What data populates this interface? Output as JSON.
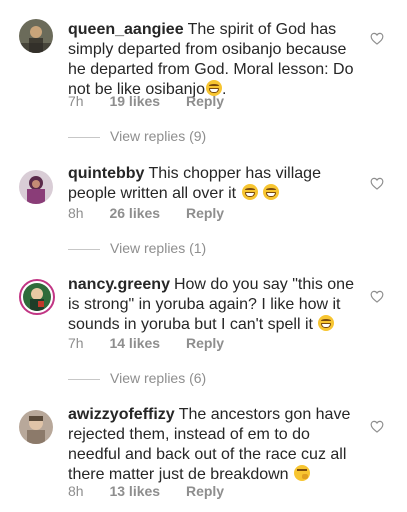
{
  "comments": [
    {
      "username": "queen_aangiee",
      "text": "The spirit of God has simply departed from osibanjo because he departed from God. Moral lesson: Do not be like osibanjo",
      "emoji": "😂",
      "time": "7h",
      "likes": "19 likes",
      "reply": "Reply",
      "view_replies": "View replies (9)"
    },
    {
      "username": "quintebby",
      "text": "This chopper has village people written all over it",
      "emoji": "😂 😂",
      "time": "8h",
      "likes": "26 likes",
      "reply": "Reply",
      "view_replies": "View replies (1)"
    },
    {
      "username": "nancy.greeny",
      "text": "How do you say \"this one is strong\" in yoruba again? I like how it sounds in yoruba but I can't spell it",
      "emoji": "😂",
      "time": "7h",
      "likes": "14 likes",
      "reply": "Reply",
      "view_replies": "View replies (6)"
    },
    {
      "username": "awizzyofeffizy",
      "text": "The ancestors gon have rejected them, instead of em to do needful and back out of the race cuz all there matter just de breakdown",
      "emoji": "🤔",
      "time": "8h",
      "likes": "13 likes",
      "reply": "Reply"
    }
  ],
  "icons": {
    "like": "heart-outline-icon",
    "avatar": "avatar"
  },
  "colors": {
    "text": "#262626",
    "muted": "#8e8e8e",
    "story_ring": "#c13584"
  }
}
